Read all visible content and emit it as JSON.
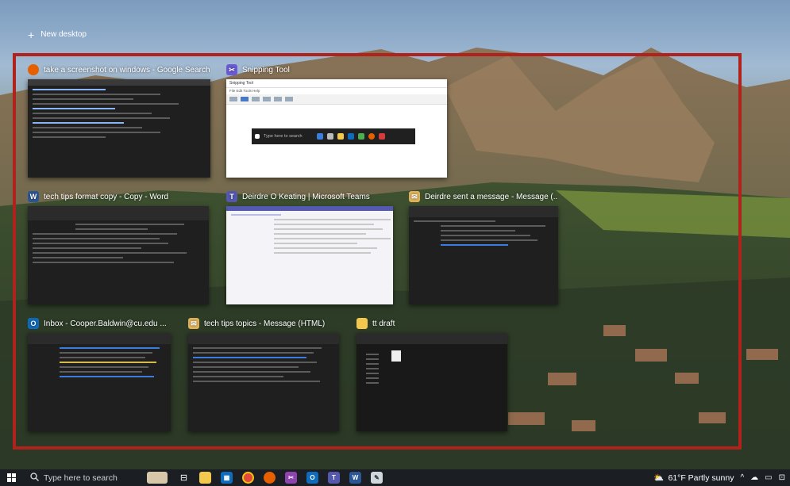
{
  "new_desktop": {
    "label": "New desktop",
    "icon": "plus-icon"
  },
  "windows": [
    {
      "title": "take a screenshot on windows - Google Search...",
      "app": "firefox",
      "icon_color": "#e66000"
    },
    {
      "title": "Snipping Tool",
      "app": "snipping-tool",
      "icon_color": "#6b5bd6",
      "inner": {
        "window_title": "Snipping Tool",
        "menu": "File  Edit  Tools  Help",
        "toolbar": "New   Mode   Delay",
        "search_placeholder": "Type here to search"
      }
    },
    {
      "title": "tech tips format copy - Copy - Word",
      "app": "word",
      "icon_color": "#2b5797"
    },
    {
      "title": "Deirdre O Keating | Microsoft Teams",
      "app": "teams",
      "icon_color": "#5558af"
    },
    {
      "title": "Deirdre sent a message - Message (...",
      "app": "outlook-message",
      "icon_color": "#e2b35a"
    },
    {
      "title": "Inbox - Cooper.Baldwin@cu.edu ...",
      "app": "outlook",
      "icon_color": "#0f6cbd"
    },
    {
      "title": "tech tips topics - Message (HTML)",
      "app": "outlook-message",
      "icon_color": "#e2b35a"
    },
    {
      "title": "tt draft",
      "app": "file-explorer",
      "icon_color": "#f2c94c"
    }
  ],
  "taskbar": {
    "search_placeholder": "Type here to search",
    "weather": "61°F  Partly sunny",
    "apps": [
      "task-view",
      "file-explorer",
      "store",
      "chrome",
      "firefox",
      "snipping-tool",
      "outlook",
      "teams",
      "word",
      "paint"
    ]
  },
  "colors": {
    "annotation_frame": "#b0221c",
    "taskbar": "#1b1f24"
  }
}
